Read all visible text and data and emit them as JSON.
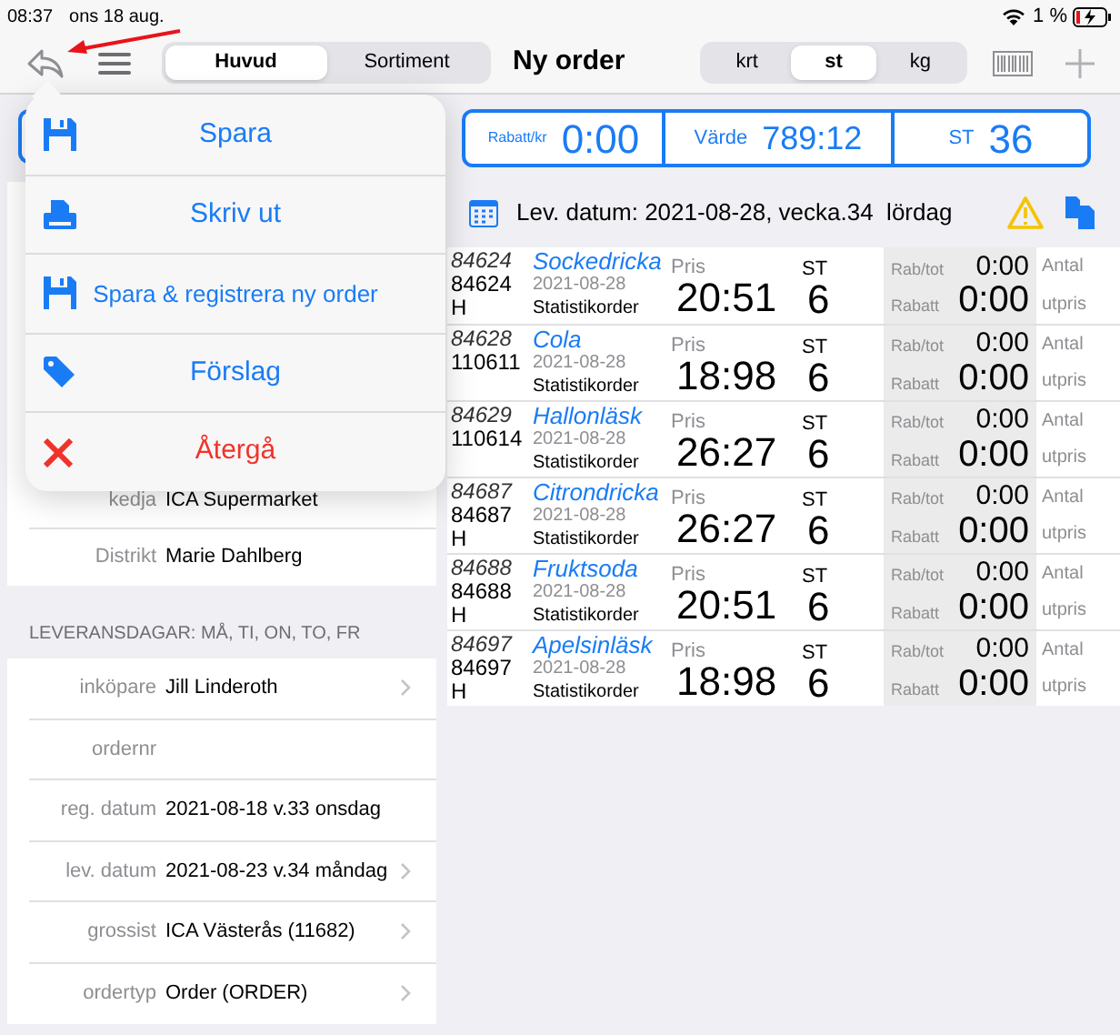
{
  "status_bar": {
    "time": "08:37",
    "date": "ons 18 aug.",
    "battery": "1 %"
  },
  "toolbar": {
    "tabs": [
      {
        "label": "Huvud",
        "selected": true
      },
      {
        "label": "Sortiment",
        "selected": false
      }
    ],
    "title": "Ny order",
    "units": [
      {
        "label": "krt",
        "selected": false
      },
      {
        "label": "st",
        "selected": true
      },
      {
        "label": "kg",
        "selected": false
      }
    ]
  },
  "menu": {
    "items": [
      {
        "label": "Spara",
        "kind": "save",
        "destructive": false
      },
      {
        "label": "Skriv ut",
        "kind": "print",
        "destructive": false
      },
      {
        "label": "Spara & registrera ny order",
        "kind": "save-new",
        "destructive": false
      },
      {
        "label": "Förslag",
        "kind": "tag",
        "destructive": false
      },
      {
        "label": "Återgå",
        "kind": "cancel",
        "destructive": true
      }
    ]
  },
  "customer": {
    "rows": [
      {
        "label": "kedja",
        "value": "ICA Supermarket"
      },
      {
        "label": "Distrikt",
        "value": "Marie Dahlberg"
      }
    ]
  },
  "delivery_days": "LEVERANSDAGAR: MÅ, TI, ON, TO, FR",
  "order_fields": [
    {
      "label": "inköpare",
      "value": "Jill Linderoth",
      "disclosure": true
    },
    {
      "label": "ordernr",
      "disclosure": false
    },
    {
      "label": "reg. datum",
      "value": "2021-08-18 v.33  onsdag",
      "disclosure": false
    },
    {
      "label": "lev. datum",
      "value": "2021-08-23 v.34  måndag",
      "disclosure": true
    },
    {
      "label": "grossist",
      "value": "ICA Västerås (11682)",
      "disclosure": true
    },
    {
      "label": "ordertyp",
      "value": "Order (ORDER)",
      "disclosure": true
    }
  ],
  "summary": [
    {
      "label": "Rabatt/kr",
      "value": "0:00"
    },
    {
      "label": "Värde",
      "value": "789:12"
    },
    {
      "label": "ST",
      "value": "36"
    }
  ],
  "delivery_line": "Lev. datum: 2021-08-28, vecka.34  lördag",
  "items": [
    {
      "article": "84624",
      "ean": "84624",
      "unit": "H",
      "name": "Sockedricka",
      "date": "2021-08-28",
      "type": "Statistikorder",
      "price_label": "Pris",
      "price": "20:51",
      "qty_label": "ST",
      "qty": "6",
      "rabtot_label": "Rab/tot",
      "rabtot": "0:00",
      "rabatt_label": "Rabatt",
      "rabatt": "0:00",
      "col_a": "Antal",
      "col_b": "utpris"
    },
    {
      "article": "84628",
      "ean": "110611",
      "name": "Cola",
      "date": "2021-08-28",
      "type": "Statistikorder",
      "price_label": "Pris",
      "price": "18:98",
      "qty_label": "ST",
      "qty": "6",
      "rabtot_label": "Rab/tot",
      "rabtot": "0:00",
      "rabatt_label": "Rabatt",
      "rabatt": "0:00",
      "col_a": "Antal",
      "col_b": "utpris"
    },
    {
      "article": "84629",
      "ean": "110614",
      "name": "Hallonläsk",
      "date": "2021-08-28",
      "type": "Statistikorder",
      "price_label": "Pris",
      "price": "26:27",
      "qty_label": "ST",
      "qty": "6",
      "rabtot_label": "Rab/tot",
      "rabtot": "0:00",
      "rabatt_label": "Rabatt",
      "rabatt": "0:00",
      "col_a": "Antal",
      "col_b": "utpris"
    },
    {
      "article": "84687",
      "ean": "84687",
      "unit": "H",
      "name": "Citrondricka",
      "date": "2021-08-28",
      "type": "Statistikorder",
      "price_label": "Pris",
      "price": "26:27",
      "qty_label": "ST",
      "qty": "6",
      "rabtot_label": "Rab/tot",
      "rabtot": "0:00",
      "rabatt_label": "Rabatt",
      "rabatt": "0:00",
      "col_a": "Antal",
      "col_b": "utpris"
    },
    {
      "article": "84688",
      "ean": "84688",
      "unit": "H",
      "name": "Fruktsoda",
      "date": "2021-08-28",
      "type": "Statistikorder",
      "price_label": "Pris",
      "price": "20:51",
      "qty_label": "ST",
      "qty": "6",
      "rabtot_label": "Rab/tot",
      "rabtot": "0:00",
      "rabatt_label": "Rabatt",
      "rabatt": "0:00",
      "col_a": "Antal",
      "col_b": "utpris"
    },
    {
      "article": "84697",
      "ean": "84697",
      "unit": "H",
      "name": "Apelsinläsk",
      "date": "2021-08-28",
      "type": "Statistikorder",
      "price_label": "Pris",
      "price": "18:98",
      "qty_label": "ST",
      "qty": "6",
      "rabtot_label": "Rab/tot",
      "rabtot": "0:00",
      "rabatt_label": "Rabatt",
      "rabatt": "0:00",
      "col_a": "Antal",
      "col_b": "utpris"
    }
  ]
}
